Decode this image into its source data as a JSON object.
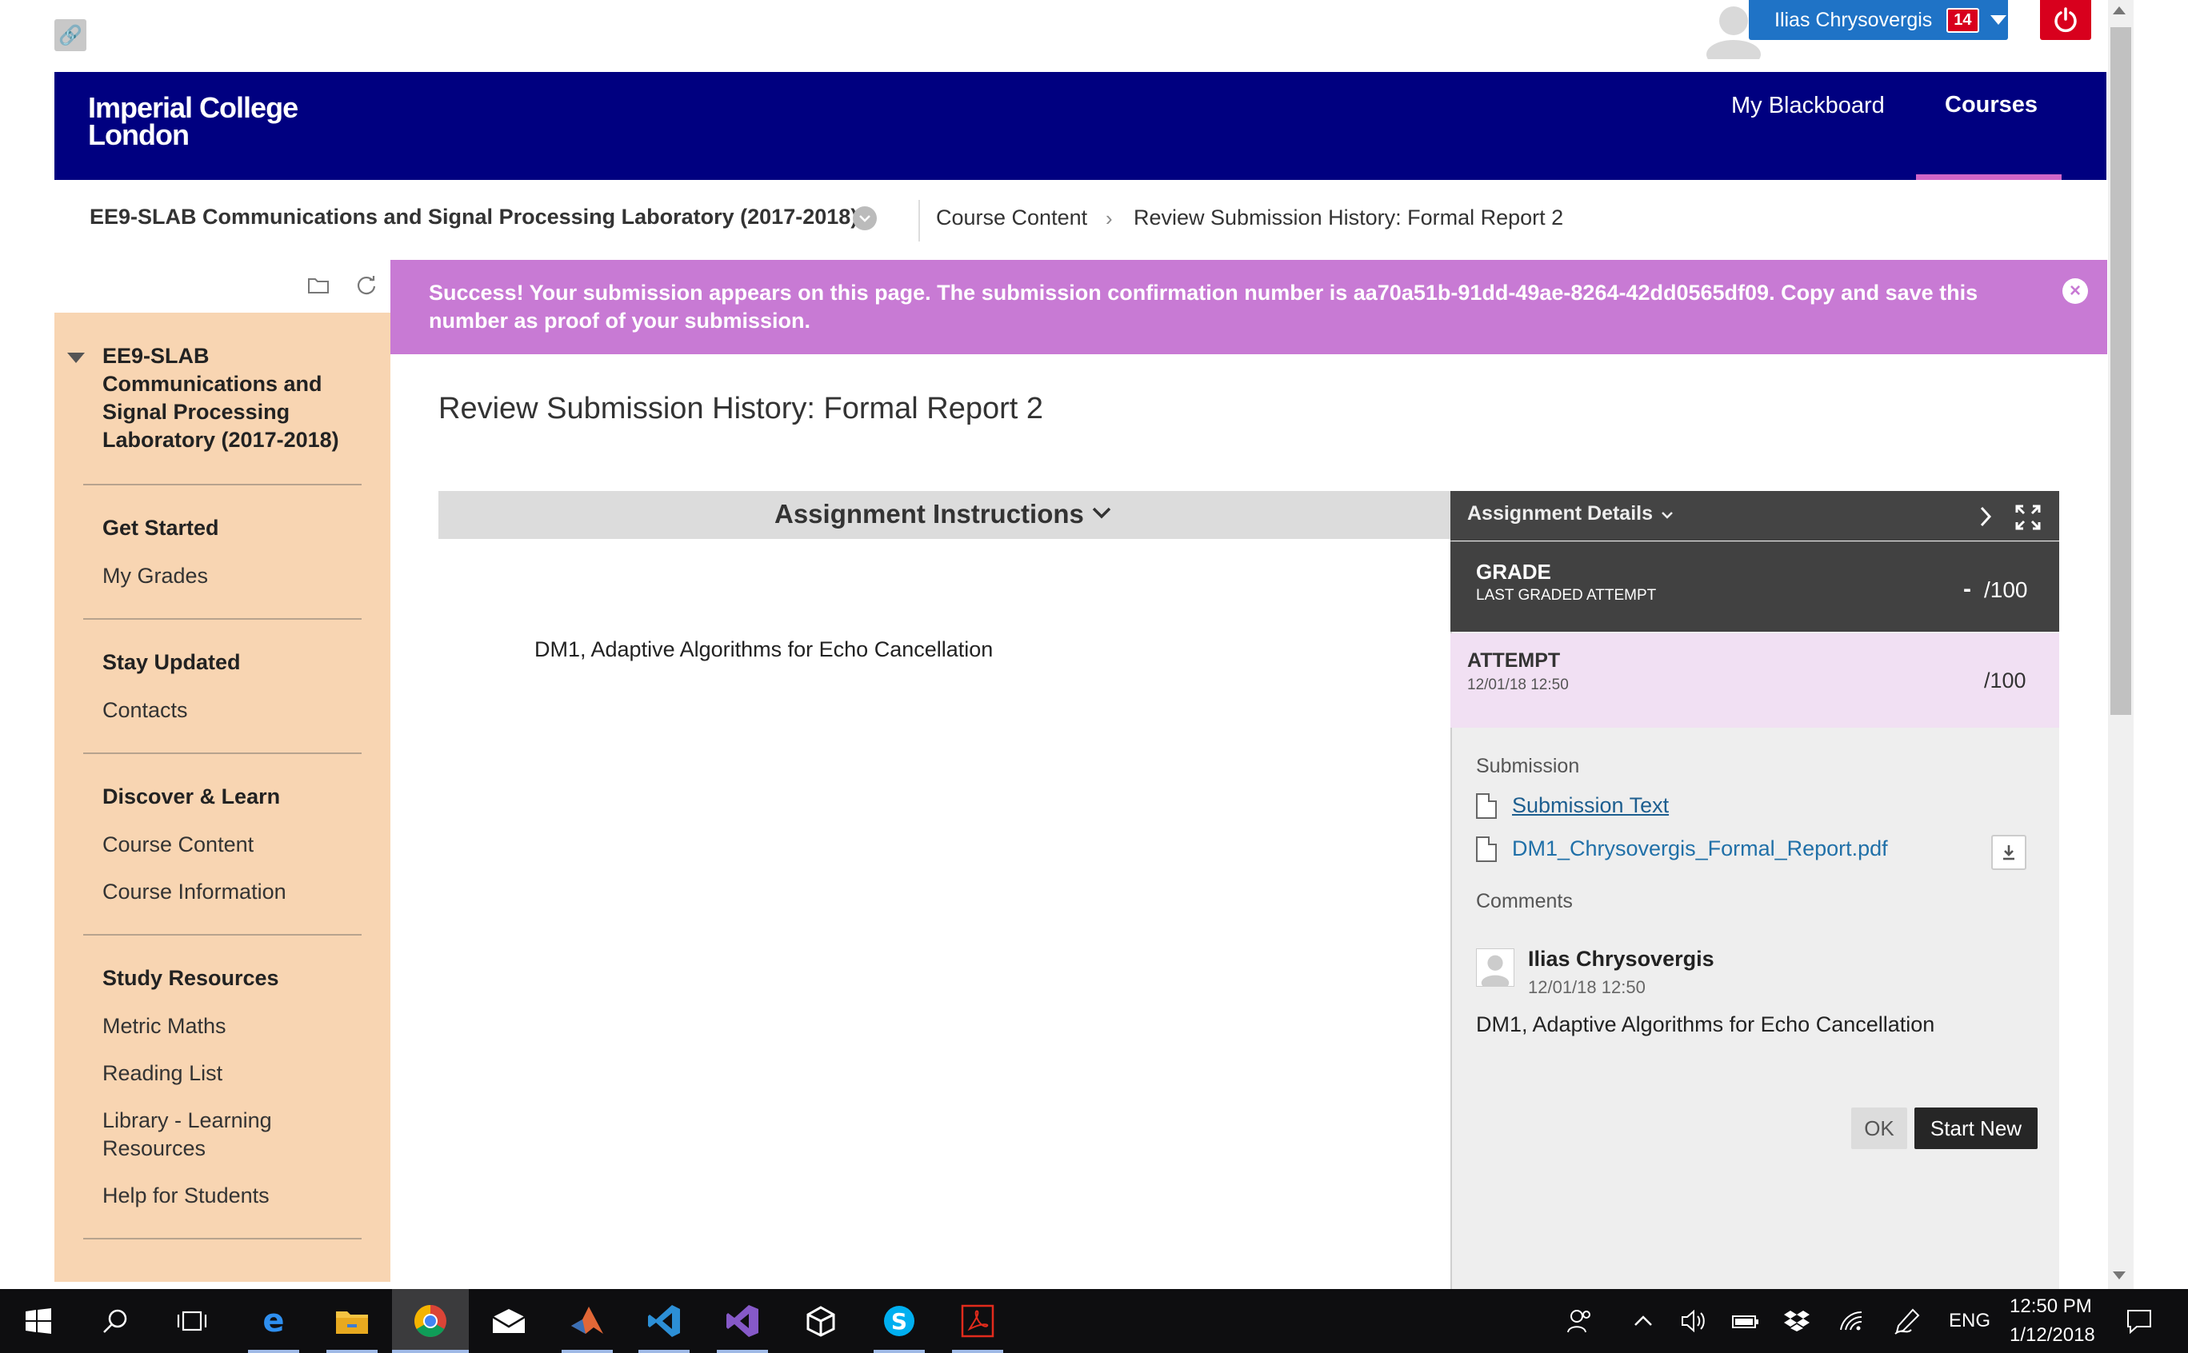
{
  "user": {
    "name": "Ilias Chrysovergis",
    "notifications": "14"
  },
  "header": {
    "logo_line1": "Imperial College",
    "logo_line2": "London",
    "nav": {
      "my_blackboard": "My Blackboard",
      "courses": "Courses"
    }
  },
  "breadcrumb": {
    "course": "EE9-SLAB Communications and Signal Processing Laboratory (2017-2018)",
    "items": [
      "Course Content",
      "Review Submission History: Formal Report 2"
    ],
    "separator": "›"
  },
  "banner": {
    "message": "Success! Your submission appears on this page. The submission confirmation number is aa70a51b-91dd-49ae-8264-42dd0565df09. Copy and save this number as proof of your submission."
  },
  "sidebar": {
    "course_title": "EE9-SLAB Communications and Signal Processing Laboratory (2017-2018)",
    "sections": [
      {
        "heading": "Get Started",
        "items": [
          "My Grades"
        ]
      },
      {
        "heading": "Stay Updated",
        "items": [
          "Contacts"
        ]
      },
      {
        "heading": "Discover & Learn",
        "items": [
          "Course Content",
          "Course Information"
        ]
      },
      {
        "heading": "Study Resources",
        "items": [
          "Metric Maths",
          "Reading List",
          "Library - Learning Resources",
          "Help for Students"
        ]
      }
    ]
  },
  "main": {
    "page_title": "Review Submission History: Formal Report 2",
    "instructions_label": "Assignment Instructions",
    "instructions_text": "DM1, Adaptive Algorithms for Echo Cancellation"
  },
  "details": {
    "header_label": "Assignment Details",
    "grade": {
      "label": "GRADE",
      "sub": "LAST GRADED ATTEMPT",
      "dash": "-",
      "value": "/100"
    },
    "attempt": {
      "label": "ATTEMPT",
      "date": "12/01/18 12:50",
      "value": "/100"
    },
    "submission_label": "Submission",
    "submission_text_link": "Submission Text",
    "file_link": "DM1_Chrysovergis_Formal_Report.pdf",
    "comments_label": "Comments",
    "comment": {
      "author": "Ilias Chrysovergis",
      "date": "12/01/18 12:50",
      "text": "DM1, Adaptive Algorithms for Echo Cancellation"
    },
    "buttons": {
      "ok": "OK",
      "start_new": "Start New"
    }
  },
  "taskbar": {
    "language": "ENG",
    "time": "12:50 PM",
    "date": "1/12/2018",
    "apps": [
      "start-icon",
      "search-icon",
      "task-view-icon",
      "edge-icon",
      "file-explorer-icon",
      "chrome-icon",
      "mail-icon",
      "matlab-icon",
      "vscode-icon",
      "visual-studio-icon",
      "unity-icon",
      "skype-icon",
      "acrobat-icon"
    ]
  },
  "colors": {
    "header_bg": "#000080",
    "sidebar_bg": "#f8d5b2",
    "banner_bg": "#c87ad4",
    "user_pill": "#1f73c6",
    "power_red": "#d8001d",
    "attempt_bg": "#f1e0f3"
  }
}
